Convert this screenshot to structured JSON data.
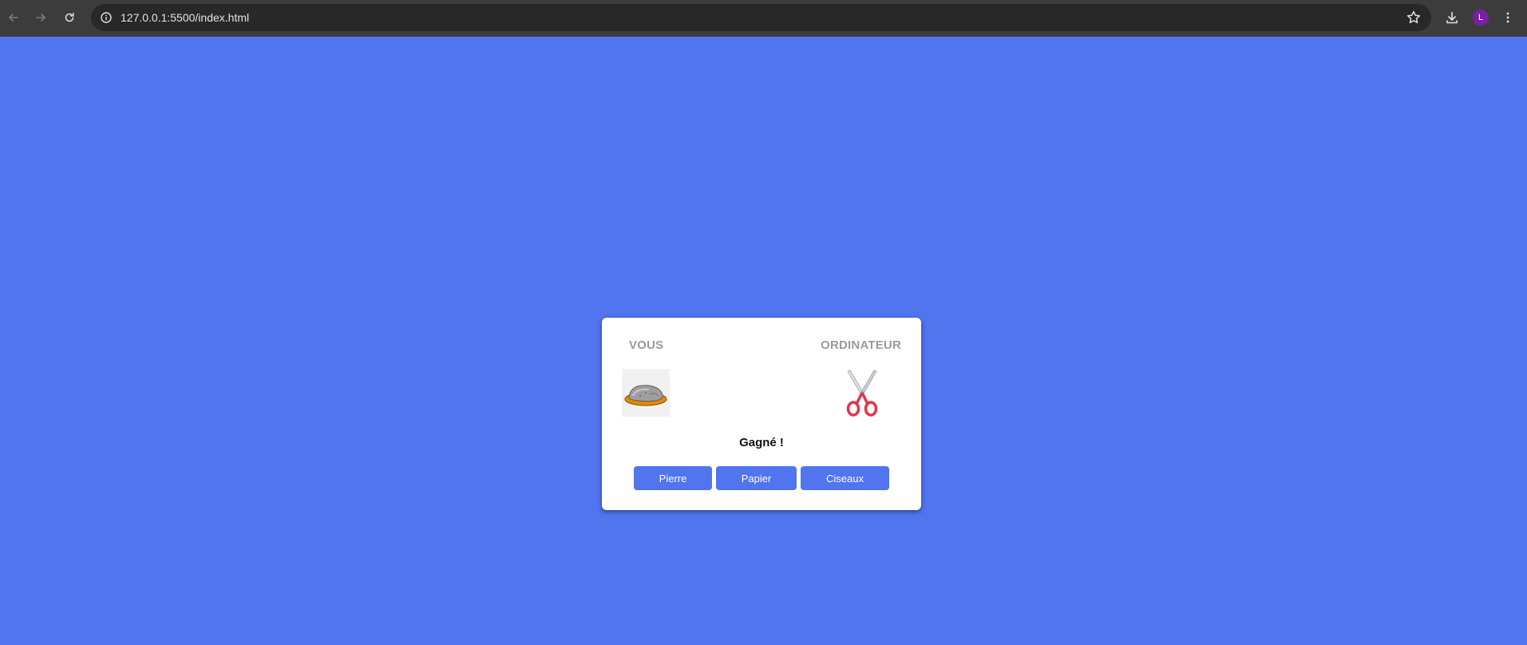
{
  "browser": {
    "url": "127.0.0.1:5500/index.html",
    "profile_initial": "L",
    "icons": [
      "back-icon",
      "forward-icon",
      "reload-icon",
      "site-info-icon",
      "bookmark-star-icon",
      "download-icon",
      "more-menu-icon"
    ]
  },
  "game": {
    "player_label": "VOUS",
    "computer_label": "ORDINATEUR",
    "player_choice": "rock-image",
    "computer_choice": "scissors-image",
    "result": "Gagné !",
    "buttons": {
      "rock": "Pierre",
      "paper": "Papier",
      "scissors": "Ciseaux"
    }
  },
  "colors": {
    "background": "#5174ef",
    "button": "#5174ef",
    "card": "#ffffff",
    "label": "#9a9a9a",
    "avatar": "#7b1fa2"
  }
}
